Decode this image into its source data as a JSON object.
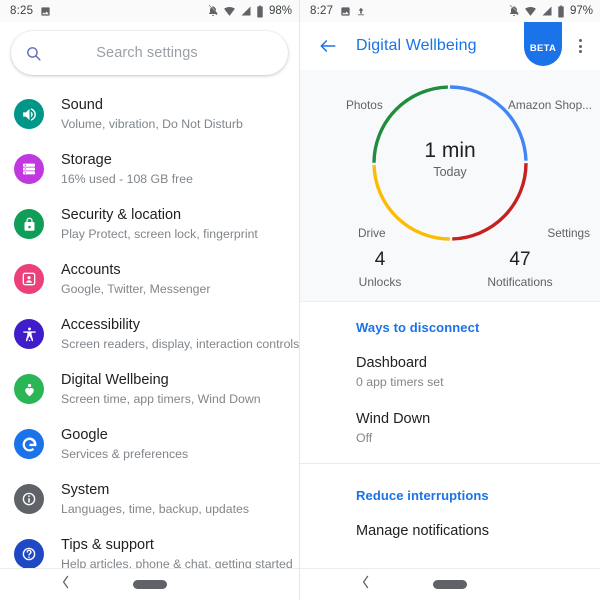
{
  "left": {
    "status": {
      "time": "8:25",
      "icons": [
        "photo-icon",
        "notifications-off-icon",
        "wifi-icon",
        "signal-icon",
        "battery-icon"
      ],
      "battery_percent": "98%"
    },
    "search": {
      "placeholder": "Search settings",
      "icon": "search-icon"
    },
    "settings": [
      {
        "title": "Sound",
        "subtitle": "Volume, vibration, Do Not Disturb",
        "icon": "sound-icon",
        "color": "#009688"
      },
      {
        "title": "Storage",
        "subtitle": "16% used - 108 GB free",
        "icon": "storage-icon",
        "color": "#c238e0"
      },
      {
        "title": "Security & location",
        "subtitle": "Play Protect, screen lock, fingerprint",
        "icon": "lock-icon",
        "color": "#0f9d58"
      },
      {
        "title": "Accounts",
        "subtitle": "Google, Twitter, Messenger",
        "icon": "account-icon",
        "color": "#ec407a"
      },
      {
        "title": "Accessibility",
        "subtitle": "Screen readers, display, interaction controls",
        "icon": "accessibility-icon",
        "color": "#3f1dcb"
      },
      {
        "title": "Digital Wellbeing",
        "subtitle": "Screen time, app timers, Wind Down",
        "icon": "wellbeing-icon",
        "color": "#2bb656"
      },
      {
        "title": "Google",
        "subtitle": "Services & preferences",
        "icon": "google-g-icon",
        "color": "#1a73e8"
      },
      {
        "title": "System",
        "subtitle": "Languages, time, backup, updates",
        "icon": "info-icon",
        "color": "#5f6368"
      },
      {
        "title": "Tips & support",
        "subtitle": "Help articles, phone & chat, getting started",
        "icon": "help-icon",
        "color": "#1f48c4"
      }
    ],
    "nav": {
      "back": "back-icon",
      "home": "home-handle"
    }
  },
  "right": {
    "status": {
      "time": "8:27",
      "icons": [
        "photo-icon",
        "upload-icon",
        "notifications-off-icon",
        "wifi-icon",
        "signal-icon",
        "battery-icon"
      ],
      "battery_percent": "97%"
    },
    "appbar": {
      "back_icon": "back-arrow-icon",
      "title": "Digital Wellbeing",
      "badge": "BETA",
      "overflow_icon": "overflow-menu-icon"
    },
    "summary": {
      "total": "1 min",
      "period": "Today",
      "stats": [
        {
          "value": "4",
          "label": "Unlocks"
        },
        {
          "value": "47",
          "label": "Notifications"
        }
      ]
    },
    "sections": [
      {
        "header": "Ways to disconnect",
        "rows": [
          {
            "title": "Dashboard",
            "subtitle": "0 app timers set"
          },
          {
            "title": "Wind Down",
            "subtitle": "Off"
          }
        ]
      },
      {
        "header": "Reduce interruptions",
        "rows": [
          {
            "title": "Manage notifications",
            "subtitle": ""
          }
        ]
      }
    ],
    "nav": {
      "back": "back-icon",
      "home": "home-handle"
    }
  },
  "chart_data": {
    "type": "pie",
    "title": "1 min",
    "subtitle": "Today",
    "categories": [
      "Amazon Shop...",
      "Settings",
      "Drive",
      "Photos"
    ],
    "values": [
      25,
      25,
      25,
      25
    ],
    "colors": [
      "#4285f4",
      "#c5221f",
      "#fbbc04",
      "#1e8e3e"
    ],
    "labels_position": "outside",
    "legend": "none",
    "donut": true
  }
}
